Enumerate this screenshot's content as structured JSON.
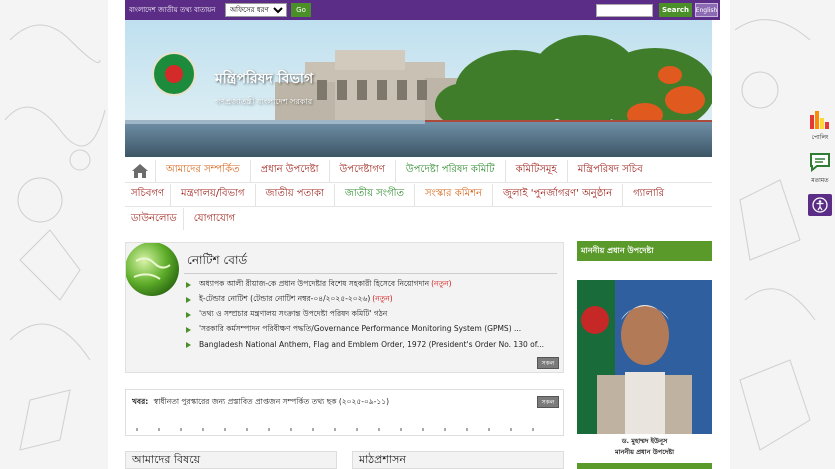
{
  "topbar": {
    "site_title": "বাংলাদেশ জাতীয় তথ্য বাতায়ন",
    "office_select": "অফিসের ধরণ",
    "go_label": "Go",
    "search_value": "",
    "search_label": "Search",
    "lang_label": "English"
  },
  "banner": {
    "org_name": "মন্ত্রিপরিষদ বিভাগ",
    "gov_name": "গণপ্রজাতন্ত্রী বাংলাদেশ সরকার"
  },
  "nav": {
    "row1": [
      "আমাদের সম্পর্কিত",
      "প্রধান উপদেষ্টা",
      "উপদেষ্টাগণ",
      "উপদেষ্টা পরিষদ কমিটি",
      "কমিটিসমূহ",
      "মন্ত্রিপরিষদ সচিব"
    ],
    "row2": [
      "সচিবগণ",
      "মন্ত্রণালয়/বিভাগ",
      "জাতীয় পতাকা",
      "জাতীয় সংগীত",
      "সংস্কার কমিশন",
      "জুলাই 'পুনর্জাগরণ' অনুষ্ঠান",
      "গ্যালারি"
    ],
    "row3": [
      "ডাউনলোড",
      "যোগাযোগ"
    ]
  },
  "notice": {
    "title": "নোটিশ বোর্ড",
    "items": [
      {
        "text": "অধ্যাপক আলী রীয়াজ-কে প্রধান উপদেষ্টার বিশেষ সহকারী হিসেবে নিয়োগদান",
        "tag": "(নতুন)"
      },
      {
        "text": "ই-টেন্ডার নোটিশ (টেন্ডার নোটিশ নম্বর-০৪/২০২৫-২০২৬)",
        "tag": "(নতুন)"
      },
      {
        "text": "'তথ্য ও সম্প্রচার মন্ত্রণালয় সংক্রান্ত উপদেষ্টা পরিষদ কমিটি' গঠন",
        "tag": ""
      },
      {
        "text": "'সরকারি কর্মসম্পাদন পরিবীক্ষণ পদ্ধতি/Governance Performance Monitoring System (GPMS) ...",
        "tag": ""
      },
      {
        "text": "Bangladesh National Anthem, Flag and Emblem Order, 1972 (President's Order No. 130 of...",
        "tag": ""
      }
    ],
    "all_label": "সকল"
  },
  "ticker": {
    "prefix": "খবর:",
    "text": "স্বাধীনতা পুরস্কারের জন্য প্রস্তাবিত প্রাপ্তজন সম্পর্কিত তথ্য ছক (২০২৫-০৯-১১)",
    "all_label": "সকল"
  },
  "sections": {
    "left": "আমাদের বিষয়ে",
    "right": "মাঠপ্রশাসন"
  },
  "side": {
    "title": "মাননীয় প্রধান উপদেষ্টা",
    "name": "ড. মুহাম্মদ ইউনূস",
    "role": "মাননীয় প্রধান উপদেষ্টা"
  },
  "tools": {
    "poll": "পোলিং",
    "feedback": "মতামত"
  },
  "colors": {
    "topbar": "#5b2d86",
    "green": "#4b8f29",
    "nav_text": "#a0251e",
    "nav_active": "#d8661b"
  }
}
